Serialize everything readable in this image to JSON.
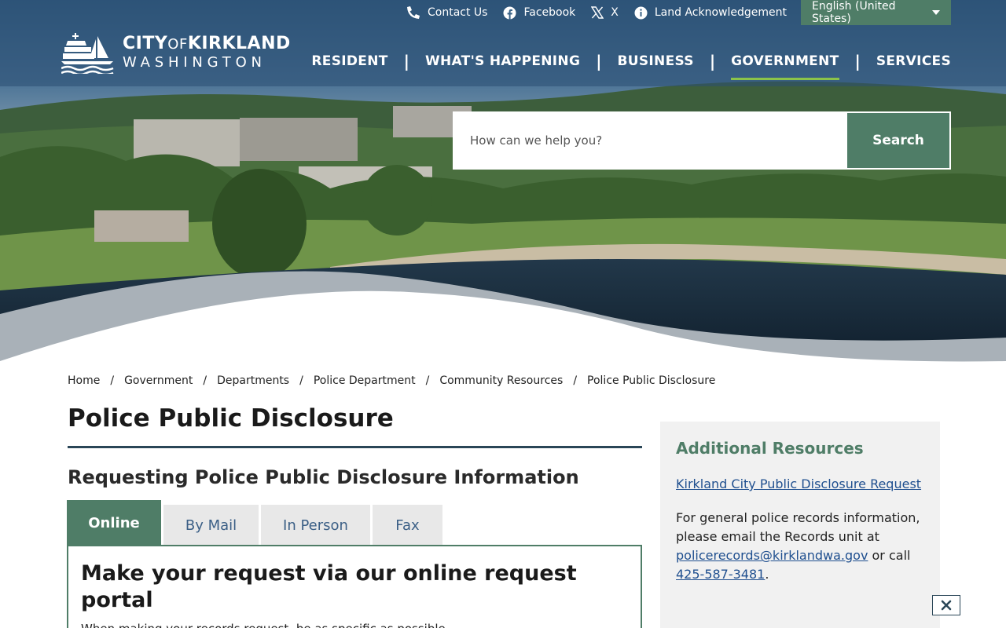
{
  "utility": {
    "contact_label": "Contact Us",
    "facebook_label": "Facebook",
    "x_label": "X",
    "land_label": "Land Acknowledgement",
    "language": "English (United States)"
  },
  "logo": {
    "line1_a": "CITY",
    "line1_b": "OF",
    "line1_c": "KIRKLAND",
    "line2": "WASHINGTON"
  },
  "nav": {
    "items": [
      {
        "label": "RESIDENT"
      },
      {
        "label": "WHAT'S HAPPENING"
      },
      {
        "label": "BUSINESS"
      },
      {
        "label": "GOVERNMENT"
      },
      {
        "label": "SERVICES"
      }
    ],
    "separator": "|"
  },
  "search": {
    "placeholder": "How can we help you?",
    "button_label": "Search"
  },
  "breadcrumb": {
    "separator": "/",
    "items": [
      {
        "label": "Home"
      },
      {
        "label": "Government"
      },
      {
        "label": "Departments"
      },
      {
        "label": "Police Department"
      },
      {
        "label": "Community Resources"
      },
      {
        "label": "Police Public Disclosure"
      }
    ]
  },
  "main": {
    "title": "Police Public Disclosure",
    "subheading": "Requesting Police Public Disclosure Information",
    "tabs": [
      {
        "label": "Online"
      },
      {
        "label": "By Mail"
      },
      {
        "label": "In Person"
      },
      {
        "label": "Fax"
      }
    ],
    "panel_title": "Make your request via our online request portal",
    "panel_text": "When making your records request, be as specific as possible."
  },
  "sidebar": {
    "title": "Additional Resources",
    "link": "Kirkland City Public Disclosure Request",
    "para_line1": "For general police records information, please email the Records unit at ",
    "email": "policerecords@kirklandwa.gov",
    "para_mid": " or call ",
    "phone": "425-587-3481",
    "para_end": "."
  },
  "colors": {
    "brand_green": "#4f7d67",
    "nav_underline": "#8bc34a",
    "link_blue": "#1f4f8f",
    "rule_navy": "#2a4657"
  }
}
